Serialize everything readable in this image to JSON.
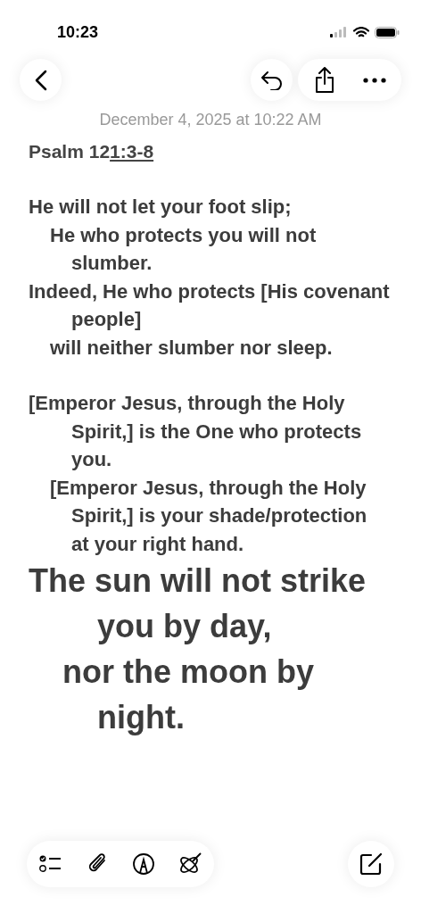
{
  "status_bar": {
    "time": "10:23"
  },
  "note": {
    "date": "December 4, 2025 at 10:22 AM",
    "title": {
      "text": "Psalm 12",
      "link": "1:3-8"
    },
    "stanzas": [
      {
        "verses": [
          {
            "kind": "primary",
            "large": false,
            "lines": [
              "He will not let your foot slip;"
            ]
          },
          {
            "kind": "secondary",
            "large": false,
            "lines": [
              "He who protects you will not",
              "slumber."
            ]
          },
          {
            "kind": "primary",
            "large": false,
            "lines": [
              "Indeed, He who protects [His covenant",
              "people]"
            ]
          },
          {
            "kind": "secondary",
            "large": false,
            "lines": [
              "will neither slumber nor sleep."
            ]
          }
        ]
      },
      {
        "verses": [
          {
            "kind": "primary",
            "large": false,
            "lines": [
              "[Emperor Jesus, through the Holy",
              "Spirit,] is the One who protects",
              "you."
            ]
          },
          {
            "kind": "secondary",
            "large": false,
            "lines": [
              "[Emperor Jesus, through the Holy",
              "Spirit,] is your shade/protection",
              "at your right hand."
            ]
          },
          {
            "kind": "primary",
            "large": true,
            "lines": [
              "The sun will not strike",
              "you by day,"
            ]
          },
          {
            "kind": "secondary",
            "large": true,
            "lines": [
              "nor the moon by",
              "night."
            ]
          }
        ]
      }
    ]
  }
}
